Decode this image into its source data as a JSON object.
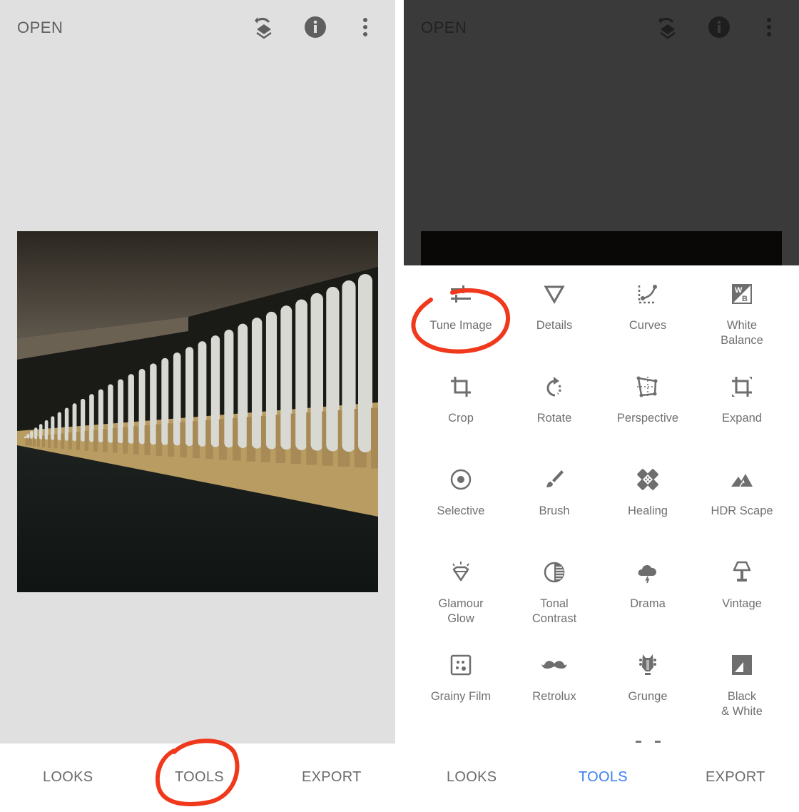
{
  "left_screen": {
    "topbar": {
      "open_label": "OPEN",
      "icons": [
        "undo-stack-icon",
        "info-icon",
        "more-vert-icon"
      ]
    },
    "photo": {
      "description": "corridor with white concrete columns"
    },
    "bottom_nav": {
      "items": [
        {
          "label": "LOOKS",
          "active": false
        },
        {
          "label": "TOOLS",
          "active": false,
          "annotated": true
        },
        {
          "label": "EXPORT",
          "active": false
        }
      ]
    }
  },
  "right_screen": {
    "topbar": {
      "open_label": "OPEN",
      "icons": [
        "undo-stack-icon",
        "info-icon",
        "more-vert-icon"
      ]
    },
    "tools": [
      {
        "label": "Tune Image",
        "icon": "tune-icon",
        "annotated": true
      },
      {
        "label": "Details",
        "icon": "triangle-down-icon"
      },
      {
        "label": "Curves",
        "icon": "curves-icon"
      },
      {
        "label": "White\nBalance",
        "icon": "white-balance-icon"
      },
      {
        "label": "Crop",
        "icon": "crop-icon"
      },
      {
        "label": "Rotate",
        "icon": "rotate-icon"
      },
      {
        "label": "Perspective",
        "icon": "perspective-icon"
      },
      {
        "label": "Expand",
        "icon": "expand-icon"
      },
      {
        "label": "Selective",
        "icon": "selective-icon"
      },
      {
        "label": "Brush",
        "icon": "brush-icon"
      },
      {
        "label": "Healing",
        "icon": "healing-icon"
      },
      {
        "label": "HDR Scape",
        "icon": "mountain-icon"
      },
      {
        "label": "Glamour\nGlow",
        "icon": "diamond-icon"
      },
      {
        "label": "Tonal\nContrast",
        "icon": "tonal-contrast-icon"
      },
      {
        "label": "Drama",
        "icon": "storm-cloud-icon"
      },
      {
        "label": "Vintage",
        "icon": "lamp-icon"
      },
      {
        "label": "Grainy Film",
        "icon": "grainy-film-icon"
      },
      {
        "label": "Retrolux",
        "icon": "mustache-icon"
      },
      {
        "label": "Grunge",
        "icon": "guitar-head-icon"
      },
      {
        "label": "Black\n& White",
        "icon": "black-white-icon"
      }
    ],
    "bottom_nav": {
      "items": [
        {
          "label": "LOOKS",
          "active": false
        },
        {
          "label": "TOOLS",
          "active": true
        },
        {
          "label": "EXPORT",
          "active": false
        }
      ]
    }
  },
  "colors": {
    "accent_active": "#3a7ff0",
    "annotation_red": "#f0391c",
    "icon_gray": "#6e6e6e"
  }
}
